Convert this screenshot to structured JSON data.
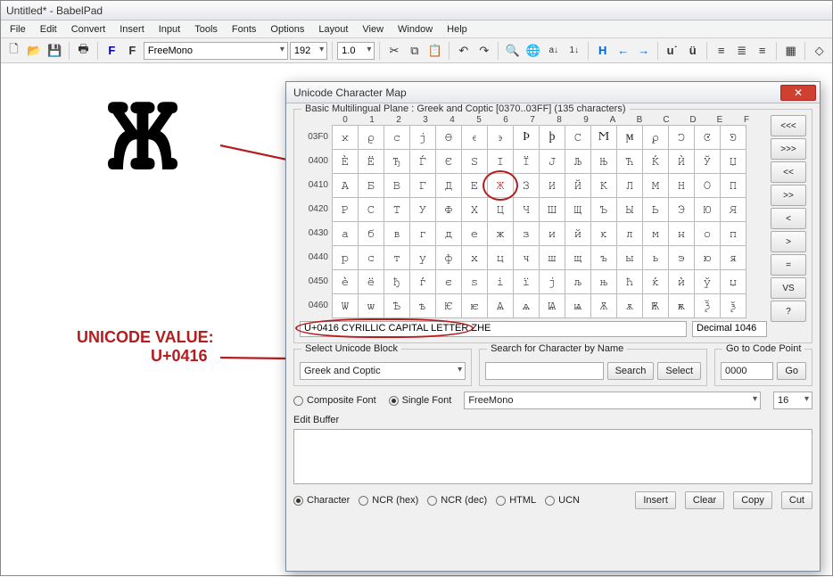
{
  "window": {
    "title": "Untitled* - BabelPad"
  },
  "menu": [
    "File",
    "Edit",
    "Convert",
    "Insert",
    "Input",
    "Tools",
    "Fonts",
    "Options",
    "Layout",
    "View",
    "Window",
    "Help"
  ],
  "toolbar": {
    "fontname": "FreeMono",
    "size": "192",
    "zoom": "1.0"
  },
  "annotation": {
    "line1": "UNICODE VALUE:",
    "line2": "U+0416",
    "glyph": "Ж"
  },
  "dialog": {
    "title": "Unicode Character Map",
    "group_title": "Basic Multilingual Plane : Greek and Coptic [0370..03FF] (135 characters)",
    "hex_cols": [
      "0",
      "1",
      "2",
      "3",
      "4",
      "5",
      "6",
      "7",
      "8",
      "9",
      "A",
      "B",
      "C",
      "D",
      "E",
      "F"
    ],
    "rows": [
      {
        "label": "03F0",
        "cells": [
          "ϰ",
          "ϱ",
          "ϲ",
          "ϳ",
          "ϴ",
          "ϵ",
          "϶",
          "Ϸ",
          "ϸ",
          "Ϲ",
          "Ϻ",
          "ϻ",
          "ϼ",
          "Ͻ",
          "Ͼ",
          "Ͽ"
        ]
      },
      {
        "label": "0400",
        "cells": [
          "Ѐ",
          "Ё",
          "Ђ",
          "Ѓ",
          "Є",
          "Ѕ",
          "І",
          "Ї",
          "Ј",
          "Љ",
          "Њ",
          "Ћ",
          "Ќ",
          "Ѝ",
          "Ў",
          "Џ"
        ]
      },
      {
        "label": "0410",
        "cells": [
          "А",
          "Б",
          "В",
          "Г",
          "Д",
          "Е",
          "Ж",
          "З",
          "И",
          "Й",
          "К",
          "Л",
          "М",
          "Н",
          "О",
          "П"
        ]
      },
      {
        "label": "0420",
        "cells": [
          "Р",
          "С",
          "Т",
          "У",
          "Ф",
          "Х",
          "Ц",
          "Ч",
          "Ш",
          "Щ",
          "Ъ",
          "Ы",
          "Ь",
          "Э",
          "Ю",
          "Я"
        ]
      },
      {
        "label": "0430",
        "cells": [
          "а",
          "б",
          "в",
          "г",
          "д",
          "е",
          "ж",
          "з",
          "и",
          "й",
          "к",
          "л",
          "м",
          "н",
          "о",
          "п"
        ]
      },
      {
        "label": "0440",
        "cells": [
          "р",
          "с",
          "т",
          "у",
          "ф",
          "х",
          "ц",
          "ч",
          "ш",
          "щ",
          "ъ",
          "ы",
          "ь",
          "э",
          "ю",
          "я"
        ]
      },
      {
        "label": "0450",
        "cells": [
          "ѐ",
          "ё",
          "ђ",
          "ѓ",
          "є",
          "ѕ",
          "і",
          "ї",
          "ј",
          "љ",
          "њ",
          "ћ",
          "ќ",
          "ѝ",
          "ў",
          "џ"
        ]
      },
      {
        "label": "0460",
        "cells": [
          "Ѡ",
          "ѡ",
          "Ѣ",
          "ѣ",
          "Ѥ",
          "ѥ",
          "Ѧ",
          "ѧ",
          "Ѩ",
          "ѩ",
          "Ѫ",
          "ѫ",
          "Ѭ",
          "ѭ",
          "Ѯ",
          "ѯ"
        ]
      }
    ],
    "nav": [
      "<<<",
      ">>>",
      "<<",
      ">>",
      "<",
      ">",
      "=",
      "VS",
      "?"
    ],
    "info_left": "U+0416 CYRILLIC CAPITAL LETTER ZHE",
    "info_right": "Decimal 1046",
    "block_label": "Select Unicode Block",
    "block_value": "Greek and Coptic",
    "search_label": "Search for Character by Name",
    "search_btn": "Search",
    "select_btn": "Select",
    "goto_label": "Go to Code Point",
    "goto_value": "0000",
    "goto_btn": "Go",
    "composite": "Composite Font",
    "single": "Single Font",
    "font_value": "FreeMono",
    "font_size": "16",
    "editbuf_label": "Edit Buffer",
    "radios": [
      "Character",
      "NCR (hex)",
      "NCR (dec)",
      "HTML",
      "UCN"
    ],
    "action_btns": [
      "Insert",
      "Clear",
      "Copy",
      "Cut"
    ]
  }
}
